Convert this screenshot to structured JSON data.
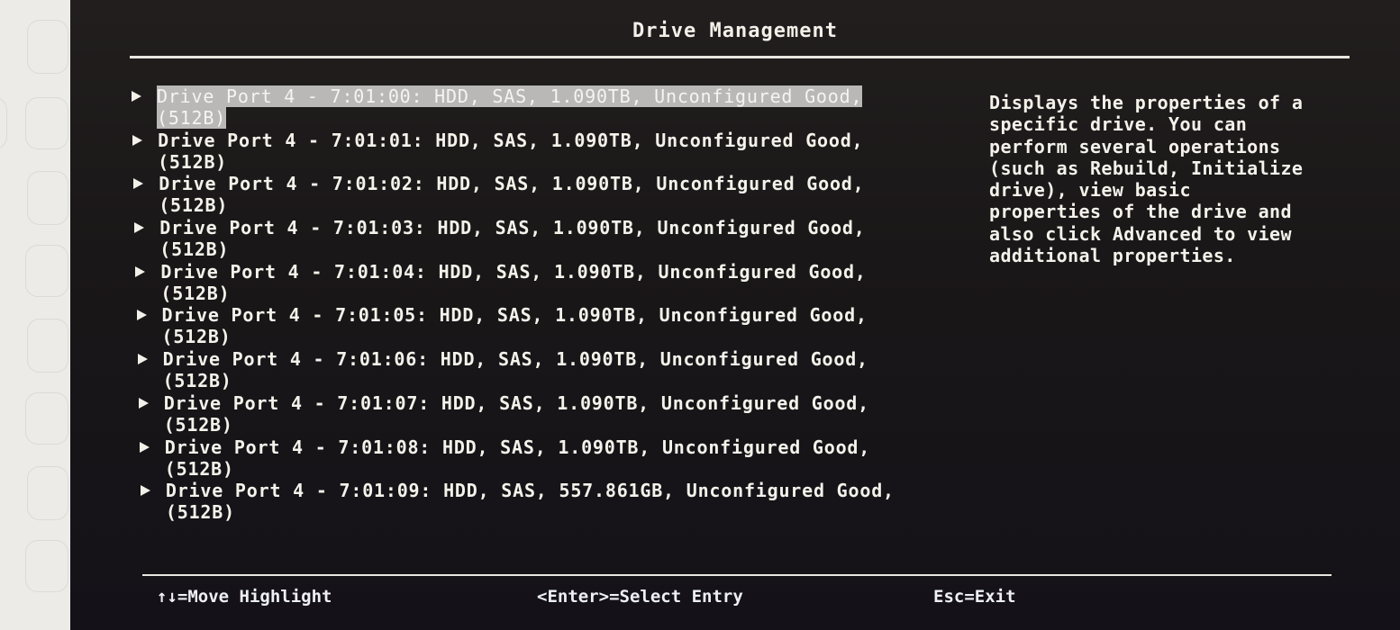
{
  "title": "Drive Management",
  "drives": [
    {
      "line1": "Drive Port 4 - 7:01:00: HDD, SAS, 1.090TB, Unconfigured Good,",
      "line2": "(512B)",
      "selected": true
    },
    {
      "line1": "Drive Port 4 - 7:01:01: HDD, SAS, 1.090TB, Unconfigured Good,",
      "line2": "(512B)",
      "selected": false
    },
    {
      "line1": "Drive Port 4 - 7:01:02: HDD, SAS, 1.090TB, Unconfigured Good,",
      "line2": "(512B)",
      "selected": false
    },
    {
      "line1": "Drive Port 4 - 7:01:03: HDD, SAS, 1.090TB, Unconfigured Good,",
      "line2": "(512B)",
      "selected": false
    },
    {
      "line1": "Drive Port 4 - 7:01:04: HDD, SAS, 1.090TB, Unconfigured Good,",
      "line2": "(512B)",
      "selected": false
    },
    {
      "line1": "Drive Port 4 - 7:01:05: HDD, SAS, 1.090TB, Unconfigured Good,",
      "line2": "(512B)",
      "selected": false
    },
    {
      "line1": "Drive Port 4 - 7:01:06: HDD, SAS, 1.090TB, Unconfigured Good,",
      "line2": "(512B)",
      "selected": false
    },
    {
      "line1": "Drive Port 4 - 7:01:07: HDD, SAS, 1.090TB, Unconfigured Good,",
      "line2": "(512B)",
      "selected": false
    },
    {
      "line1": "Drive Port 4 - 7:01:08: HDD, SAS, 1.090TB, Unconfigured Good,",
      "line2": "(512B)",
      "selected": false
    },
    {
      "line1": "Drive Port 4 - 7:01:09: HDD, SAS, 557.861GB, Unconfigured Good,",
      "line2": "(512B)",
      "selected": false
    }
  ],
  "help_text": "Displays the properties of a\nspecific drive. You can\nperform several operations\n(such as Rebuild, Initialize\ndrive), view basic\nproperties of the drive and\nalso click Advanced to view\nadditional properties.",
  "footer": {
    "move": "↑↓=Move Highlight",
    "select": "<Enter>=Select Entry",
    "exit": "Esc=Exit"
  },
  "colors": {
    "background": "#1a1718",
    "text": "#f4f2ea",
    "highlight": "#b9b8b6"
  }
}
